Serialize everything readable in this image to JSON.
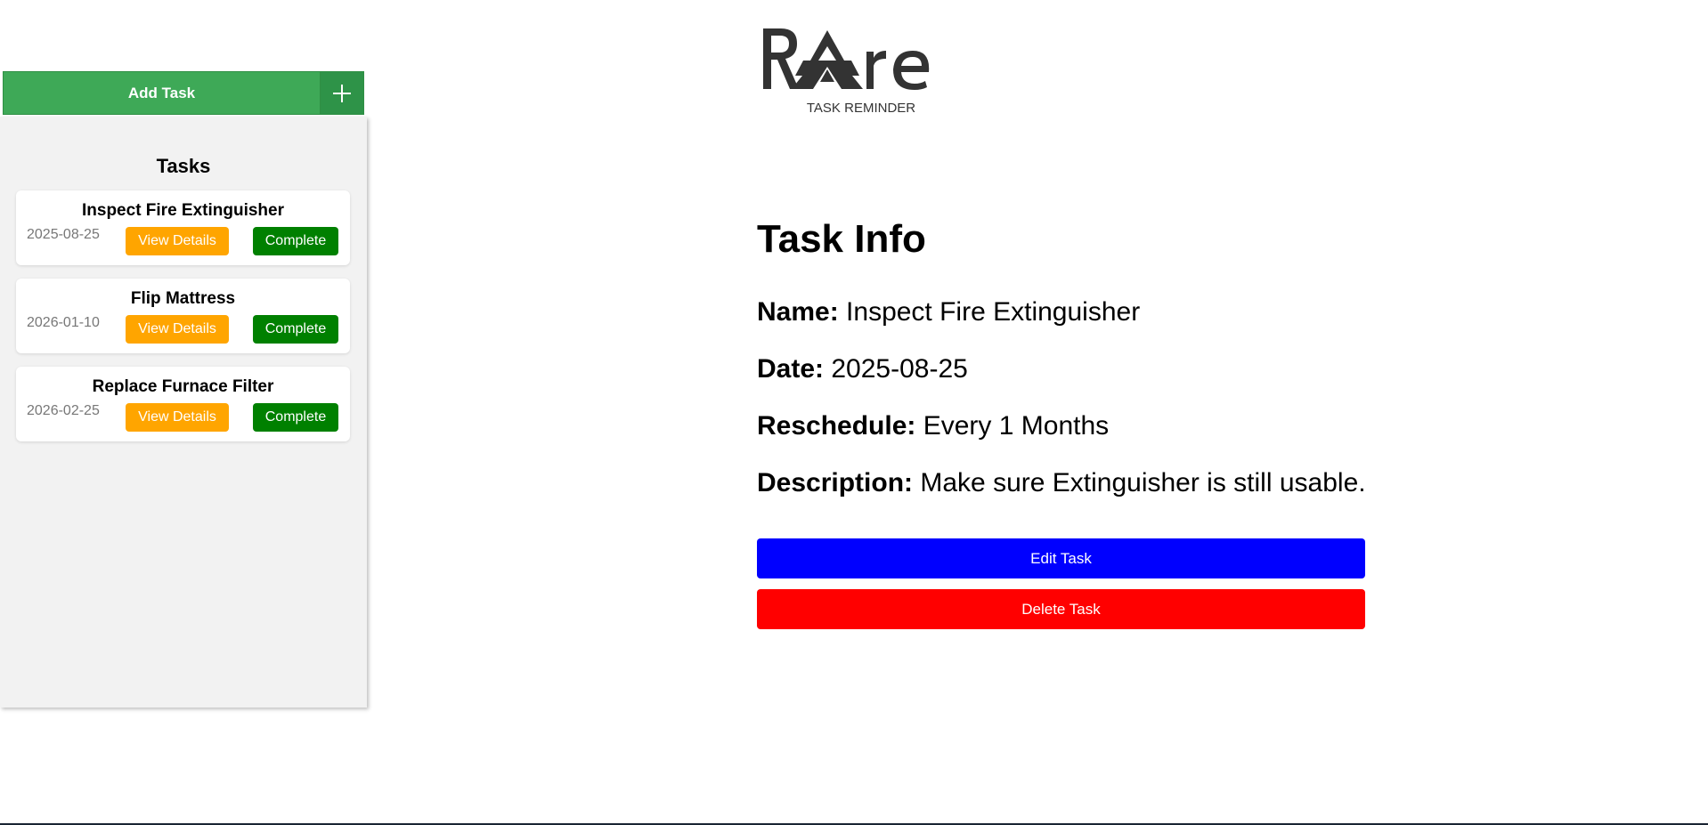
{
  "add_task": {
    "label": "Add Task",
    "icon": "plus-icon"
  },
  "sidebar": {
    "title": "Tasks",
    "tasks": [
      {
        "name": "Inspect Fire Extinguisher",
        "date": "2025-08-25",
        "view_label": "View Details",
        "complete_label": "Complete"
      },
      {
        "name": "Flip Mattress",
        "date": "2026-01-10",
        "view_label": "View Details",
        "complete_label": "Complete"
      },
      {
        "name": "Replace Furnace Filter",
        "date": "2026-02-25",
        "view_label": "View Details",
        "complete_label": "Complete"
      }
    ]
  },
  "logo": {
    "brand": "Rare",
    "tagline": "TASK REMINDER"
  },
  "task_info": {
    "title": "Task Info",
    "name_label": "Name:",
    "name_value": "Inspect Fire Extinguisher",
    "date_label": "Date:",
    "date_value": "2025-08-25",
    "reschedule_label": "Reschedule:",
    "reschedule_value": "Every 1 Months",
    "description_label": "Description:",
    "description_value": "Make sure Extinguisher is still usable.",
    "edit_label": "Edit Task",
    "delete_label": "Delete Task"
  },
  "colors": {
    "add_task": "#3ea957",
    "view_details": "#ffa500",
    "complete": "#008000",
    "edit": "#0000ff",
    "delete": "#ff0000"
  }
}
